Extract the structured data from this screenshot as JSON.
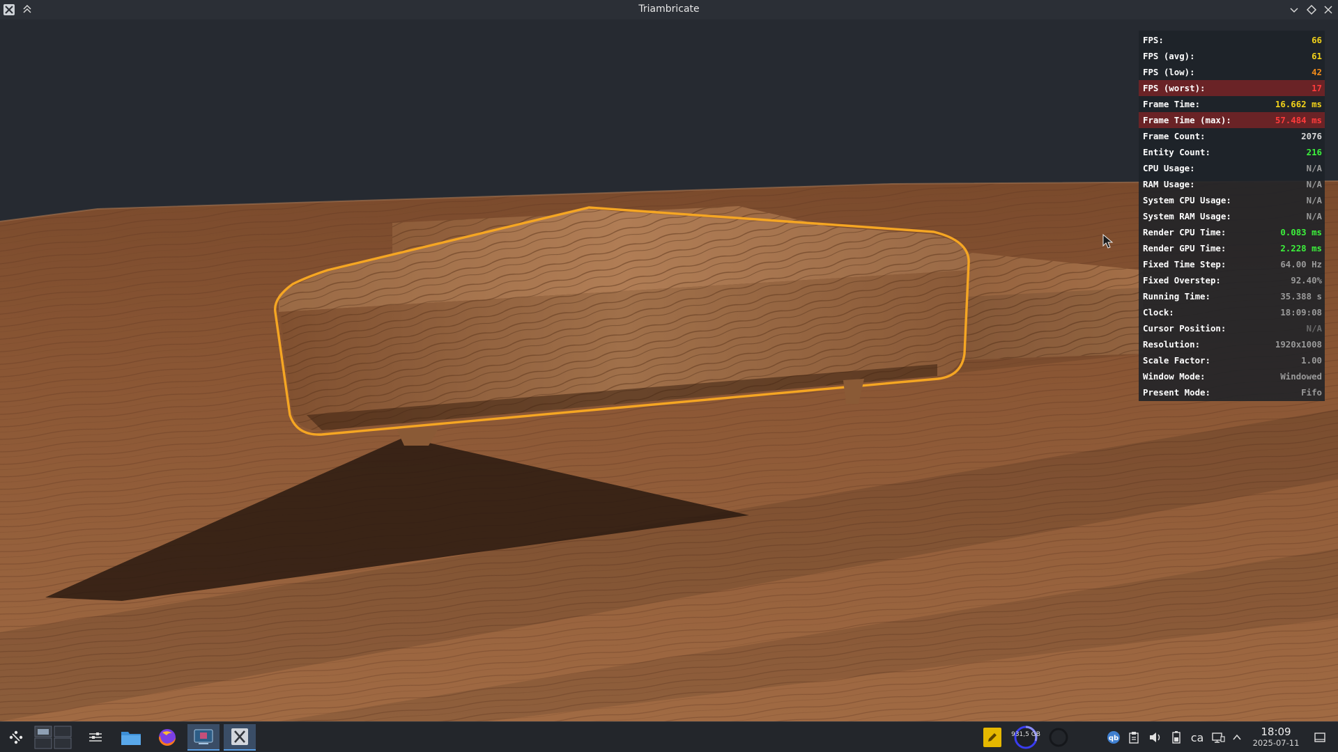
{
  "window": {
    "title": "Triambricate",
    "icon": "x-app-icon"
  },
  "diagnostics": [
    {
      "label": "FPS:",
      "value": "66",
      "color": "#f2d21a",
      "alert": false
    },
    {
      "label": "FPS (avg):",
      "value": "61",
      "color": "#f2d21a",
      "alert": false
    },
    {
      "label": "FPS (low):",
      "value": "42",
      "color": "#f08a1a",
      "alert": false
    },
    {
      "label": "FPS (worst):",
      "value": "17",
      "color": "#ff3b3b",
      "alert": true
    },
    {
      "label": "Frame Time:",
      "value": "16.662 ms",
      "color": "#f2d21a",
      "alert": false
    },
    {
      "label": "Frame Time (max):",
      "value": "57.484 ms",
      "color": "#ff3b3b",
      "alert": true
    },
    {
      "label": "Frame Count:",
      "value": "2076",
      "color": "#d8d8d8",
      "alert": false
    },
    {
      "label": "Entity Count:",
      "value": "216",
      "color": "#3cf03c",
      "alert": false
    },
    {
      "label": "CPU Usage:",
      "value": "N/A",
      "color": "#9a9a9a",
      "alert": false
    },
    {
      "label": "RAM Usage:",
      "value": "N/A",
      "color": "#9a9a9a",
      "alert": false
    },
    {
      "label": "System CPU Usage:",
      "value": "N/A",
      "color": "#9a9a9a",
      "alert": false
    },
    {
      "label": "System RAM Usage:",
      "value": "N/A",
      "color": "#9a9a9a",
      "alert": false
    },
    {
      "label": "Render CPU Time:",
      "value": "0.083 ms",
      "color": "#3cf03c",
      "alert": false
    },
    {
      "label": "Render GPU Time:",
      "value": "2.228 ms",
      "color": "#3cf03c",
      "alert": false
    },
    {
      "label": "Fixed Time Step:",
      "value": "64.00 Hz",
      "color": "#9a9a9a",
      "alert": false
    },
    {
      "label": "Fixed Overstep:",
      "value": "92.40%",
      "color": "#9a9a9a",
      "alert": false
    },
    {
      "label": "Running Time:",
      "value": "35.388 s",
      "color": "#9a9a9a",
      "alert": false
    },
    {
      "label": "Clock:",
      "value": "18:09:08",
      "color": "#9a9a9a",
      "alert": false
    },
    {
      "label": "Cursor Position:",
      "value": "N/A",
      "color": "#6a6a6a",
      "alert": false
    },
    {
      "label": "Resolution:",
      "value": "1920x1008",
      "color": "#9a9a9a",
      "alert": false
    },
    {
      "label": "Scale Factor:",
      "value": "1.00",
      "color": "#9a9a9a",
      "alert": false
    },
    {
      "label": "Window Mode:",
      "value": "Windowed",
      "color": "#9a9a9a",
      "alert": false
    },
    {
      "label": "Present Mode:",
      "value": "Fifo",
      "color": "#9a9a9a",
      "alert": false
    }
  ],
  "taskbar": {
    "disk_usage": "931,5 GB",
    "clock_time": "18:09",
    "clock_date": "2025-07-11",
    "keyboard_layout": "ca"
  },
  "colors": {
    "selection_outline": "#f5a623",
    "wood_light": "#b07a4e",
    "wood_dark": "#6a3f22",
    "background_sky": "#262a31"
  }
}
